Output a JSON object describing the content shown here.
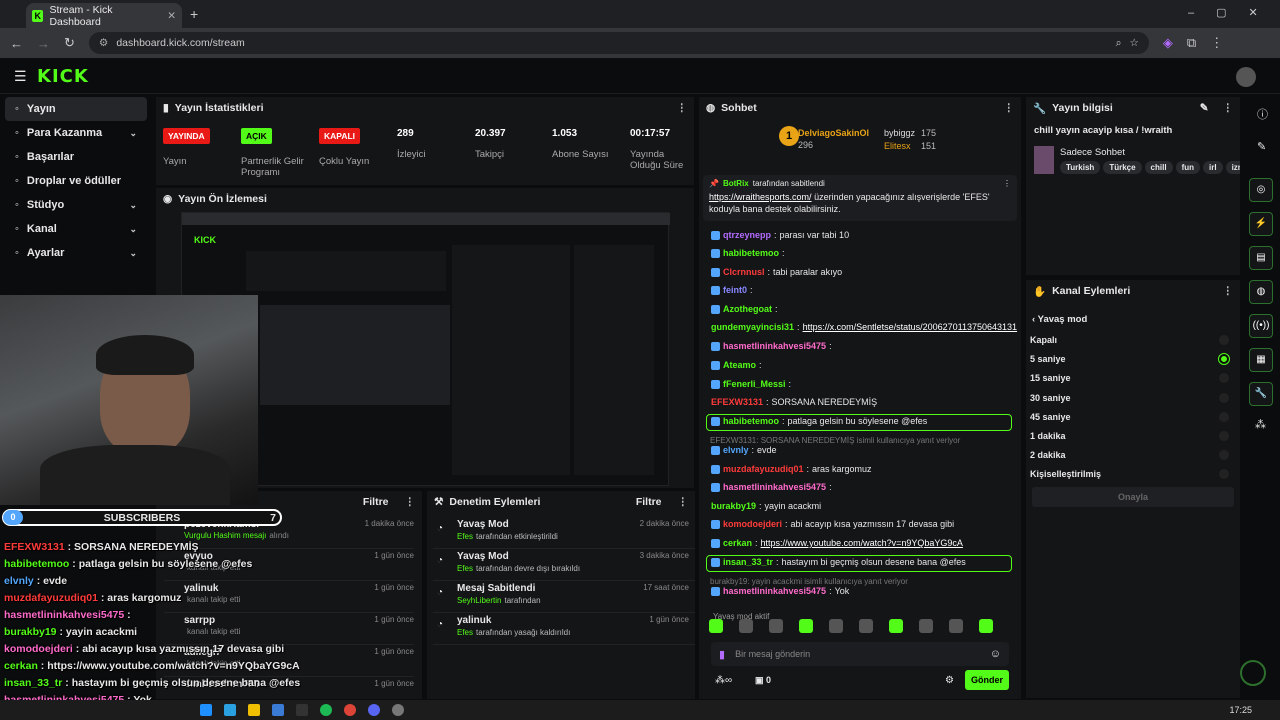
{
  "browser": {
    "tab_title": "Stream - Kick Dashboard",
    "url": "dashboard.kick.com/stream"
  },
  "brand": {
    "logo": "KICK",
    "accent": "#53fc18"
  },
  "sidebar": {
    "items": [
      {
        "label": "Yayın",
        "icon": "broadcast-icon"
      },
      {
        "label": "Para Kazanma",
        "icon": "dollar-icon",
        "chev": true
      },
      {
        "label": "Başarılar",
        "icon": "trophy-icon"
      },
      {
        "label": "Droplar ve ödüller",
        "icon": "gift-icon"
      },
      {
        "label": "Stüdyo",
        "icon": "studio-icon",
        "chev": true
      },
      {
        "label": "Kanal",
        "icon": "user-icon",
        "chev": true
      },
      {
        "label": "Ayarlar",
        "icon": "gear-icon",
        "chev": true
      }
    ]
  },
  "stats": {
    "title": "Yayın İstatistikleri",
    "live_badge": "YAYINDA",
    "live_label": "Yayın",
    "partner_badge": "AÇIK",
    "partner_label": "Partnerlik Gelir Programı",
    "multi_badge": "KAPALI",
    "multi_label": "Çoklu Yayın",
    "viewers": "289",
    "viewers_label": "İzleyici",
    "followers": "20.397",
    "followers_label": "Takipçi",
    "subs": "1.053",
    "subs_label": "Abone Sayısı",
    "uptime": "00:17:57",
    "uptime_label": "Yayında Olduğu Süre"
  },
  "preview": {
    "title": "Yayın Ön İzlemesi"
  },
  "activity": {
    "filter": "Filtre",
    "rows": [
      {
        "user": "pezevenkHamsi",
        "action": "Vurgulu Hashim mesajı",
        "suffix": "alındı",
        "time": "1 dakika önce"
      },
      {
        "user": "evyuo",
        "action": "",
        "suffix": "kanalı takip etti",
        "time": "1 gün önce"
      },
      {
        "user": "yalinuk",
        "action": "",
        "suffix": "kanalı takip etti",
        "time": "1 gün önce"
      },
      {
        "user": "sarrpp",
        "action": "",
        "suffix": "kanalı takip etti",
        "time": "1 gün önce"
      },
      {
        "user": "adilegi7",
        "action": "",
        "suffix": "kanalı takip etti",
        "time": "1 gün önce"
      },
      {
        "user": "dankeschon555",
        "action": "",
        "suffix": "",
        "time": "1 gün önce"
      }
    ]
  },
  "modlog": {
    "title": "Denetim Eylemleri",
    "filter": "Filtre",
    "rows": [
      {
        "title": "Yavaş Mod",
        "who": "Efes",
        "desc": "tarafından etkinleştirildi",
        "time": "2 dakika önce"
      },
      {
        "title": "Yavaş Mod",
        "who": "Efes",
        "desc": "tarafından devre dışı bırakıldı",
        "time": "3 dakika önce"
      },
      {
        "title": "Mesaj Sabitlendi",
        "who": "SeyhLibertin",
        "desc": "tarafından",
        "time": "17 saat önce"
      },
      {
        "title": "yalinuk",
        "who": "Efes",
        "desc": "tarafından yasağı kaldırıldı",
        "time": "1 gün önce"
      }
    ]
  },
  "chat": {
    "title": "Sohbet",
    "top1": "DelviagoSakinOl",
    "top1_val": "296",
    "top2": "bybiggz",
    "top2_val": "175",
    "top3": "Elitesx",
    "top3_val": "151",
    "pinned_by": "BotRix",
    "pinned_by_suffix": "tarafından sabitlendi",
    "pinned_link": "https://wraithesports.com/",
    "pinned_text": "üzerinden yapacağınız alışverişlerde 'EFES' koduyla bana destek olabilirsiniz.",
    "slow_notice": "Yavaş mod aktif",
    "input_placeholder": "Bir mesaj gönderin",
    "send": "Gönder",
    "points": "0",
    "messages": [
      {
        "u": "qtrzeynepp",
        "t": "parası var tabi 10",
        "c": "#b36bff"
      },
      {
        "u": "habibetemoo",
        "t": "",
        "c": "#53fc18"
      },
      {
        "u": "Clcrnnusl",
        "t": "tabi paralar akıyo",
        "c": "#ff3b3b"
      },
      {
        "u": "feint0",
        "t": "",
        "c": "#8888ff"
      },
      {
        "u": "Azothegoat",
        "t": "",
        "c": "#53fc18"
      },
      {
        "u": "gundemyayincisi31",
        "t": "https://x.com/Sentletse/status/2006270113750643131",
        "c": "#53fc18"
      },
      {
        "u": "hasmetlininkahvesi5475",
        "t": "",
        "c": "#ff6bcb"
      },
      {
        "u": "Ateamo",
        "t": "",
        "c": "#53fc18"
      },
      {
        "u": "fFenerli_Messi",
        "t": "",
        "c": "#53fc18"
      },
      {
        "u": "EFEXW3131",
        "t": "SORSANA NEREDEYMİŞ",
        "c": "#ff3b3b"
      },
      {
        "u": "habibetemoo",
        "t": "patlaga gelsin bu söylesene @efes",
        "c": "#53fc18"
      },
      {
        "u": "elvnly",
        "t": "evde",
        "c": "#53a6fc"
      },
      {
        "u": "muzdafayuzudiq01",
        "t": "aras kargomuz",
        "c": "#ff3b3b"
      },
      {
        "u": "hasmetlininkahvesi5475",
        "t": "",
        "c": "#ff6bcb"
      },
      {
        "u": "burakby19",
        "t": "yayin acackmi",
        "c": "#53fc18"
      },
      {
        "u": "komodoejderi",
        "t": "abi acayıp kısa yazmıssın 17 devasa gibi",
        "c": "#ff3b3b"
      },
      {
        "u": "cerkan",
        "t": "https://www.youtube.com/watch?v=n9YQbaYG9cA",
        "c": "#53fc18"
      },
      {
        "u": "insan_33_tr",
        "t": "hastayım bi geçmiş olsun desene bana @efes",
        "c": "#53fc18"
      },
      {
        "u": "hasmetlininkahvesi5475",
        "t": "Yok",
        "c": "#ff6bcb"
      }
    ],
    "reply1": "EFEXW3131: SORSANA NEREDEYMİŞ isimli kullanıcıya yanıt veriyor",
    "reply2": "burakby19: yayin acackmi isimli kullanıcıya yanıt veriyor"
  },
  "info": {
    "title": "Yayın bilgisi",
    "stream_title": "chill yayın acayip kısa / !wraith",
    "category": "Sadece Sohbet",
    "tags": [
      "Turkish",
      "Türkçe",
      "chill",
      "fun",
      "irl",
      "izm"
    ]
  },
  "actions": {
    "title": "Kanal Eylemleri",
    "back": "Yavaş mod",
    "options": [
      "Kapalı",
      "5 saniye",
      "15 saniye",
      "30 saniye",
      "45 saniye",
      "1 dakika",
      "2 dakika",
      "Kişiselleştirilmiş"
    ],
    "selected": 1,
    "confirm": "Onayla"
  },
  "overlay": {
    "subs_label": "SUBSCRIBERS",
    "subs_min": "0",
    "subs_max": "7",
    "lines": [
      {
        "u": "EFEXW3131",
        "t": "SORSANA NEREDEYMİŞ",
        "c": "#ff3b3b"
      },
      {
        "u": "habibetemoo",
        "t": "patlaga gelsin bu söylesene @efes",
        "c": "#53fc18"
      },
      {
        "u": "elvnly",
        "t": "evde",
        "c": "#53a6fc"
      },
      {
        "u": "muzdafayuzudiq01",
        "t": "aras kargomuz",
        "c": "#ff3b3b"
      },
      {
        "u": "hasmetlininkahvesi5475",
        "t": "",
        "c": "#ff6bcb"
      },
      {
        "u": "burakby19",
        "t": "yayin acackmi",
        "c": "#53fc18"
      },
      {
        "u": "komodoejderi",
        "t": "abi acayıp kısa yazmıssın 17 devasa gibi",
        "c": "#ff6bcb"
      },
      {
        "u": "cerkan",
        "t": "https://www.youtube.com/watch?v=n9YQbaYG9cA",
        "c": "#53fc18"
      },
      {
        "u": "insan_33_tr",
        "t": "hastayım bi geçmiş olsun desene bana @efes",
        "c": "#53fc18"
      },
      {
        "u": "hasmetlininkahvesi5475",
        "t": "Yok",
        "c": "#ff6bcb"
      }
    ]
  },
  "taskbar": {
    "time": "17:25"
  }
}
